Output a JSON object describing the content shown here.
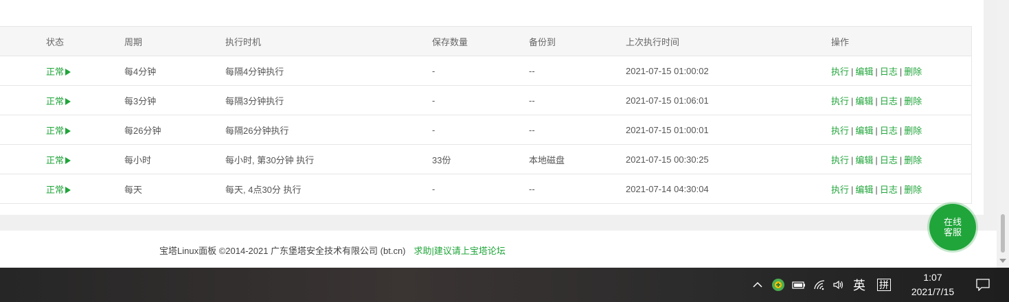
{
  "table": {
    "headers": [
      "",
      "状态",
      "周期",
      "执行时机",
      "保存数量",
      "备份到",
      "上次执行时间",
      "操作"
    ],
    "rows": [
      {
        "status": "正常",
        "period": "每4分钟",
        "timing": "每隔4分钟执行",
        "keep": "-",
        "backup": "--",
        "last_run": "2021-07-15 01:00:02"
      },
      {
        "status": "正常",
        "period": "每3分钟",
        "timing": "每隔3分钟执行",
        "keep": "-",
        "backup": "--",
        "last_run": "2021-07-15 01:06:01"
      },
      {
        "status": "正常",
        "period": "每26分钟",
        "timing": "每隔26分钟执行",
        "keep": "-",
        "backup": "--",
        "last_run": "2021-07-15 01:00:01"
      },
      {
        "status": "正常",
        "period": "每小时",
        "timing": "每小时, 第30分钟 执行",
        "keep": "33份",
        "backup": "本地磁盘",
        "last_run": "2021-07-15 00:30:25"
      },
      {
        "status": "正常",
        "period": "每天",
        "timing": "每天, 4点30分 执行",
        "keep": "-",
        "backup": "--",
        "last_run": "2021-07-14 04:30:04"
      }
    ],
    "operations": {
      "run": "执行",
      "edit": "编辑",
      "log": "日志",
      "delete": "删除",
      "separator": "|"
    }
  },
  "footer": {
    "copyright": "宝塔Linux面板 ©2014-2021 广东堡塔安全技术有限公司 (bt.cn)",
    "forum_link": "求助|建议请上宝塔论坛"
  },
  "service_button": {
    "line1": "在线",
    "line2": "客服"
  },
  "taskbar": {
    "ime": "英",
    "ime2": "拼",
    "time": "1:07",
    "date": "2021/7/15"
  },
  "colors": {
    "accent": "#20a53a"
  }
}
